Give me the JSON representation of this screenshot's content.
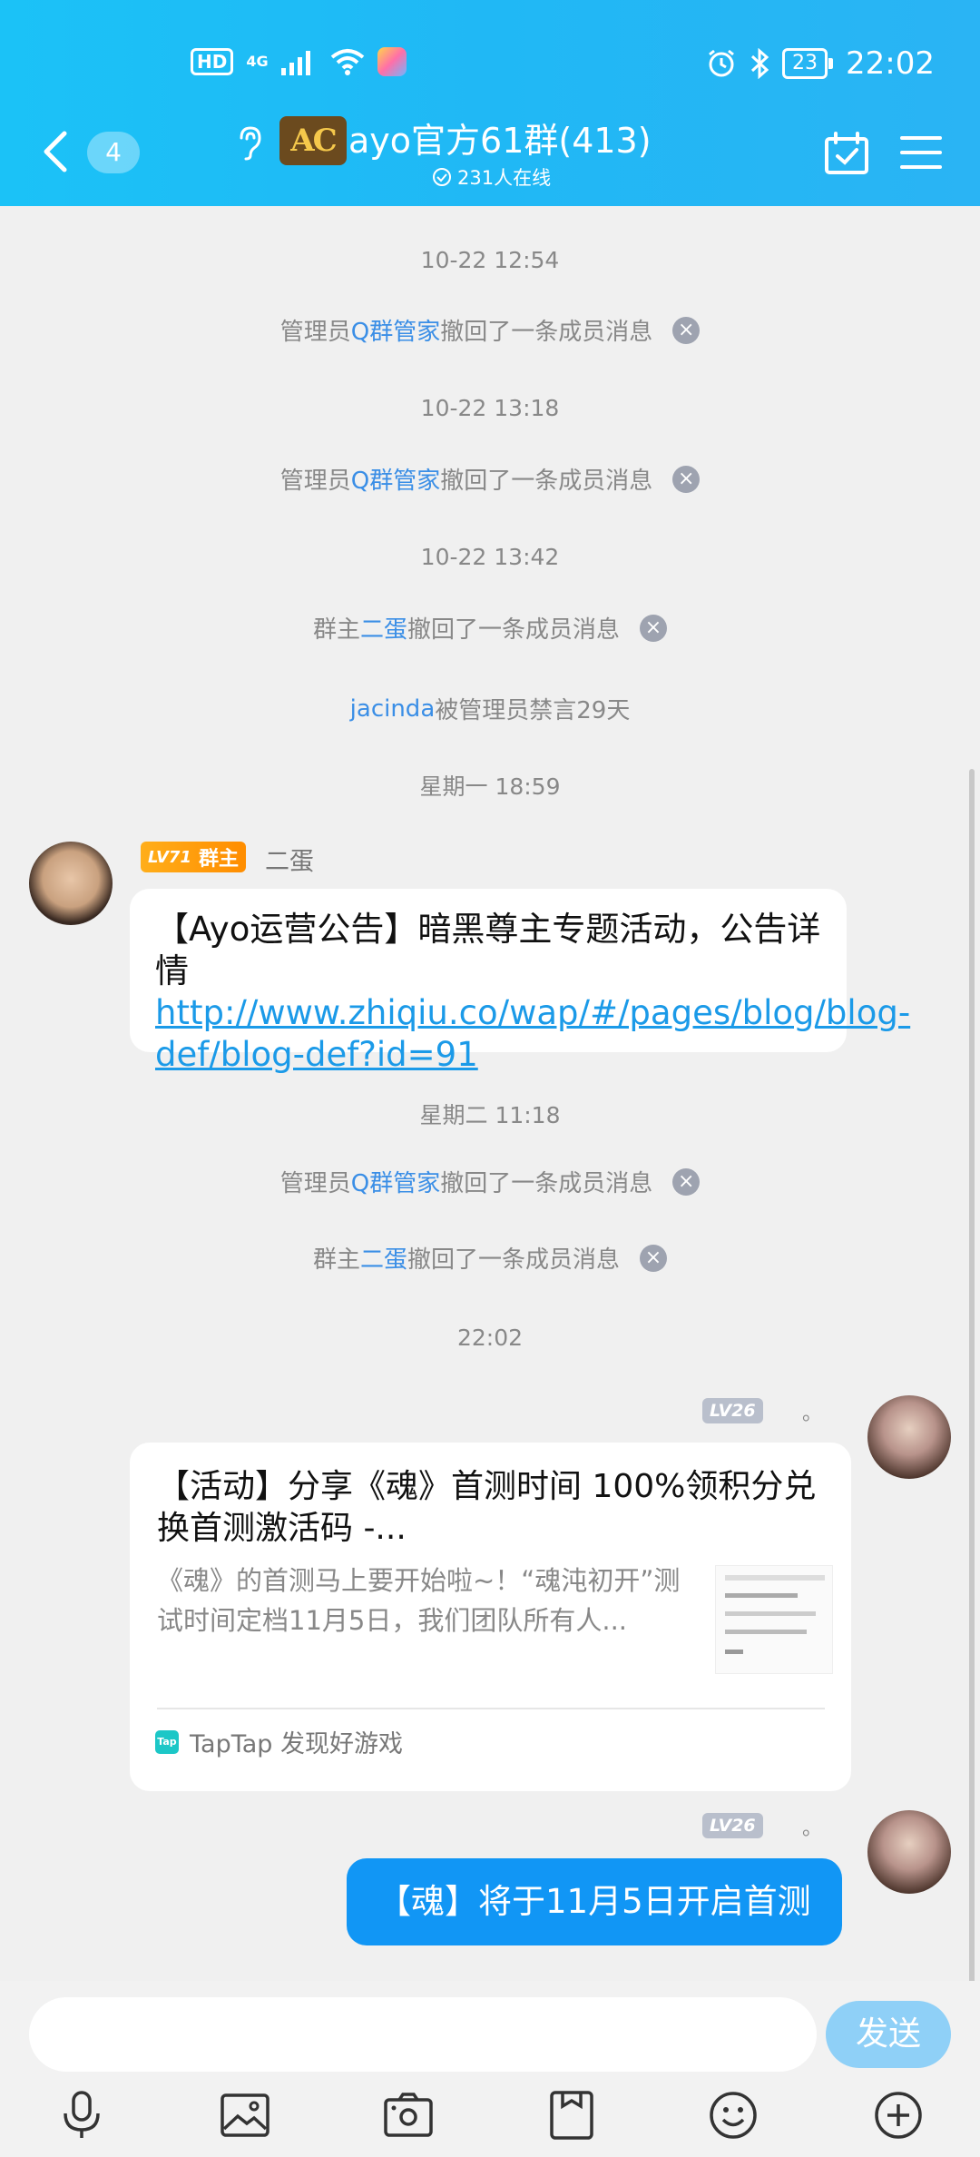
{
  "status_bar": {
    "hd": "HD",
    "network": "4G",
    "battery": "23",
    "time": "22:02"
  },
  "header": {
    "unread_count": "4",
    "group_logo_text": "AC",
    "group_title": "ayo官方61群(413)",
    "online_text": "231人在线",
    "accent_color": "#1bc2f7"
  },
  "chat": {
    "timestamps": {
      "t1": "10-22 12:54",
      "t2": "10-22 13:18",
      "t3": "10-22 13:42",
      "t4": "星期一 18:59",
      "t5": "星期二 11:18",
      "t6": "22:02"
    },
    "system": {
      "admin_prefix": "管理员",
      "admin_name": "Q群管家",
      "recall_suffix": "撤回了一条成员消息",
      "owner_prefix": "群主",
      "owner_name": "二蛋",
      "banned_user": "jacinda",
      "banned_text": " 被管理员禁言29天"
    },
    "owner_message": {
      "level": "LV71",
      "role": "群主",
      "sender": "二蛋",
      "text": "【Ayo运营公告】暗黑尊主专题活动，公告详情",
      "link": "http://www.zhiqiu.co/wap/#/pages/blog/blog-def/blog-def?id=91"
    },
    "my_level": "LV26",
    "my_dot": "。",
    "share_card": {
      "title": "【活动】分享《魂》首测时间 100%领积分兑换首测激活码 -...",
      "description": "《魂》的首测马上要开始啦~！“魂沌初开”测试时间定档11月5日，我们团队所有人...",
      "source_icon": "Tap",
      "source": "TapTap 发现好游戏"
    },
    "last_message": "【魂】将于11月5日开启首测"
  },
  "input": {
    "placeholder": "",
    "send_label": "发送"
  },
  "toolbar": {
    "icons": [
      "microphone-icon",
      "image-icon",
      "camera-icon",
      "file-icon",
      "emoji-icon",
      "plus-icon"
    ]
  }
}
